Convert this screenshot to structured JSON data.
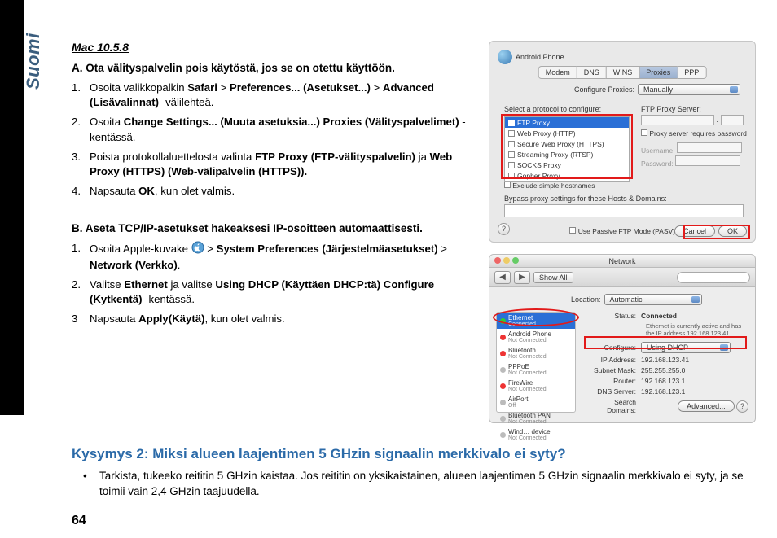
{
  "sideLabel": "Suomi",
  "osHeading": "Mac 10.5.8",
  "sectionA": {
    "title": "A. Ota välityspalvelin pois käytöstä, jos se on otettu käyttöön.",
    "steps": [
      {
        "num": "1.",
        "pre": "Osoita valikkopalkin ",
        "b1": "Safari",
        "gt1": " > ",
        "b2": "Preferences... (Asetukset...)",
        "gt2": " > ",
        "b3": "Advanced (Lisävalinnat)",
        "post": " -välilehteä."
      },
      {
        "num": "2.",
        "pre": "Osoita ",
        "b1": "Change Settings... (Muuta asetuksia...) Proxies (Välityspalvelimet)",
        "post": " -kentässä."
      },
      {
        "num": "3.",
        "pre": "Poista protokollaluettelosta valinta ",
        "b1": "FTP Proxy (FTP-välityspalvelin)",
        "mid": " ja ",
        "b2": "Web Proxy (HTTPS) (Web-välipalvelin (HTTPS))."
      },
      {
        "num": "4.",
        "pre": "Napsauta ",
        "b1": "OK",
        "post": ", kun olet valmis."
      }
    ]
  },
  "sectionB": {
    "title": "B. Aseta TCP/IP-asetukset hakeaksesi IP-osoitteen automaattisesti.",
    "steps": [
      {
        "num": "1.",
        "pre": "Osoita Apple-kuvake ",
        "gt": " > ",
        "b1": "System Preferences (Järjestelmäasetukset)",
        "gt2": " > ",
        "b2": "Network (Verkko)",
        "post": "."
      },
      {
        "num": "2.",
        "pre": "Valitse ",
        "b1": "Ethernet",
        "mid": " ja valitse ",
        "b2": "Using DHCP (Käyttäen DHCP:tä) Configure  (Kytkentä)",
        "post": " -kentässä."
      },
      {
        "num": "3",
        "pre": "Napsauta ",
        "b1": "Apply(Käytä)",
        "post": ", kun olet valmis."
      }
    ]
  },
  "q2": {
    "title": "Kysymys 2:   Miksi alueen laajentimen 5 GHzin signaalin merkkivalo ei syty?",
    "bullet": "Tarkista, tukeeko reititin 5 GHzin kaistaa. Jos reititin on yksikaistainen, alueen laajentimen 5 GHzin signaalin merkkivalo ei syty, ja se toimii vain 2,4 GHzin taajuudella."
  },
  "pageNumber": "64",
  "shot1": {
    "device": "Android Phone",
    "tabs": [
      "Modem",
      "DNS",
      "WINS",
      "Proxies",
      "PPP"
    ],
    "configLabel": "Configure Proxies:",
    "configValue": "Manually",
    "selectLabel": "Select a protocol to configure:",
    "protocols": [
      "FTP Proxy",
      "Web Proxy (HTTP)",
      "Secure Web Proxy (HTTPS)",
      "Streaming Proxy (RTSP)",
      "SOCKS Proxy",
      "Gopher Proxy"
    ],
    "exclude": "Exclude simple hostnames",
    "proxyServerLabel": "FTP Proxy Server:",
    "requiresPwd": "Proxy server requires password",
    "userLabel": "Username:",
    "pwdLabel": "Password:",
    "bypass": "Bypass proxy settings for these Hosts & Domains:",
    "passive": "Use Passive FTP Mode (PASV)",
    "cancel": "Cancel",
    "ok": "OK"
  },
  "shot2": {
    "winTitle": "Network",
    "showAll": "Show All",
    "locationLabel": "Location:",
    "locationValue": "Automatic",
    "services": [
      {
        "name": "Ethernet",
        "sub": "Connected",
        "dot": "green",
        "sel": true
      },
      {
        "name": "Android Phone",
        "sub": "Not Connected",
        "dot": "red"
      },
      {
        "name": "Bluetooth",
        "sub": "Not Connected",
        "dot": "red"
      },
      {
        "name": "PPPoE",
        "sub": "Not Connected",
        "dot": "off"
      },
      {
        "name": "FireWire",
        "sub": "Not Connected",
        "dot": "red"
      },
      {
        "name": "AirPort",
        "sub": "Off",
        "dot": "off"
      },
      {
        "name": "Bluetooth PAN",
        "sub": "Not Connected",
        "dot": "off"
      },
      {
        "name": "Wind… device",
        "sub": "Not Connected",
        "dot": "off"
      }
    ],
    "statusLabel": "Status:",
    "statusValue": "Connected",
    "statusDesc": "Ethernet is currently active and has the IP address 192.168.123.41.",
    "configLabel": "Configure:",
    "configValue": "Using DHCP",
    "ip": {
      "k": "IP Address:",
      "v": "192.168.123.41"
    },
    "mask": {
      "k": "Subnet Mask:",
      "v": "255.255.255.0"
    },
    "router": {
      "k": "Router:",
      "v": "192.168.123.1"
    },
    "dns": {
      "k": "DNS Server:",
      "v": "192.168.123.1"
    },
    "search": {
      "k": "Search Domains:",
      "v": ""
    },
    "advanced": "Advanced..."
  }
}
